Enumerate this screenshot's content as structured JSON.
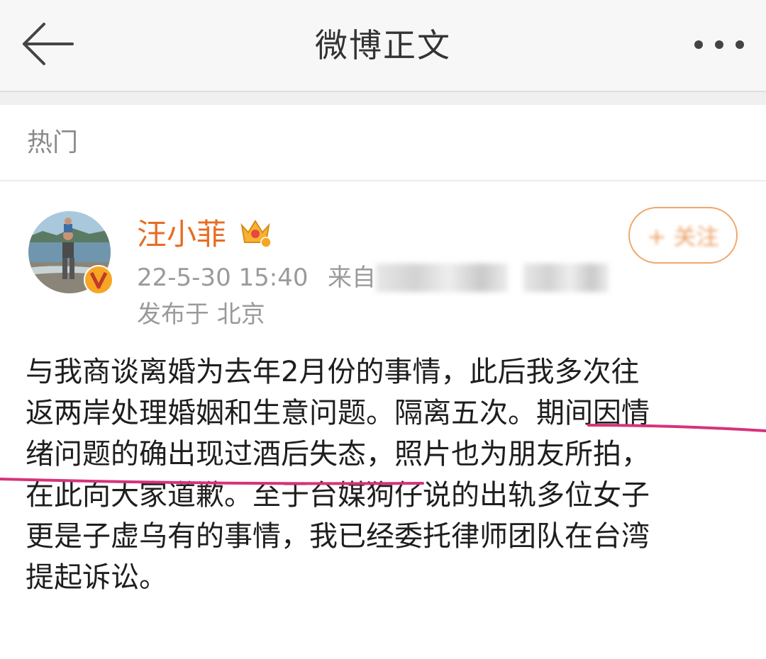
{
  "header": {
    "title": "微博正文",
    "back_icon": "arrow-left-icon",
    "more_icon": "more-dots-icon"
  },
  "section": {
    "label": "热门"
  },
  "post": {
    "author": "汪小菲",
    "time": "22-5-30 15:40",
    "source_prefix": "来自",
    "location": "发布于 北京",
    "follow_label": "+ 关注",
    "lines": [
      "与我商谈离婚为去年2月份的事情，此后我多次往",
      "返两岸处理婚姻和生意问题。隔离五次。期间因情",
      "绪问题的确出现过酒后失态，照片也为朋友所拍，",
      "在此向大家道歉。至于台媒狗仔说的出轨多位女子",
      "更是子虚乌有的事情，我已经委托律师团队在台湾",
      "提起诉讼。"
    ]
  },
  "colors": {
    "username": "#e86c22",
    "follow_border": "#f0a768",
    "underline": "#d6337a",
    "meta": "#9a9a9a"
  }
}
